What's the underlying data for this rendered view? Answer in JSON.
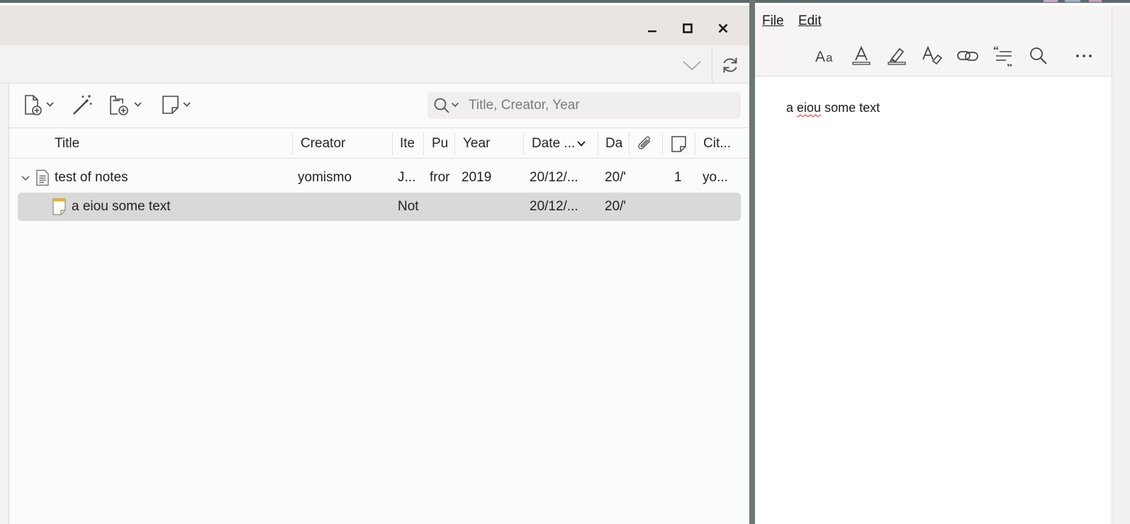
{
  "main_window": {
    "search": {
      "placeholder": "Title, Creator, Year"
    },
    "columns": [
      {
        "key": "title",
        "label": "Title"
      },
      {
        "key": "creator",
        "label": "Creator"
      },
      {
        "key": "item_type",
        "label": "Ite"
      },
      {
        "key": "publication",
        "label": "Pu"
      },
      {
        "key": "year",
        "label": "Year"
      },
      {
        "key": "date_added",
        "label": "Date ..."
      },
      {
        "key": "date_modified",
        "label": "Da"
      },
      {
        "key": "attachments",
        "label": ""
      },
      {
        "key": "notes",
        "label": ""
      },
      {
        "key": "citation",
        "label": "Cit..."
      }
    ],
    "rows": [
      {
        "title": "test of notes",
        "creator": "yomismo",
        "item_type": "J...",
        "publication": "fror",
        "year": "2019",
        "date_added": "20/12/...",
        "date_modified": "20/'",
        "notes": "1",
        "citation": "yo..."
      },
      {
        "title": "a eiou some text",
        "creator": "",
        "item_type": "Not",
        "publication": "",
        "year": "",
        "date_added": "20/12/...",
        "date_modified": "20/'",
        "notes": "",
        "citation": ""
      }
    ],
    "colors": {
      "selection": "#d9d9d9",
      "titlebar": "#e8e5e3",
      "frame": "#5d6b6b"
    }
  },
  "note_window": {
    "menu": {
      "file": "File",
      "edit": "Edit"
    },
    "toolbar_icons": [
      "text-format-icon",
      "text-color-icon",
      "highlight-icon",
      "clear-formatting-icon",
      "link-icon",
      "citation-icon",
      "find-icon",
      "more-icon"
    ],
    "note_text": {
      "word1": "a",
      "word2": "eiou",
      "rest": "some text"
    },
    "colors": {
      "spellcheck": "#d11f1f"
    }
  }
}
